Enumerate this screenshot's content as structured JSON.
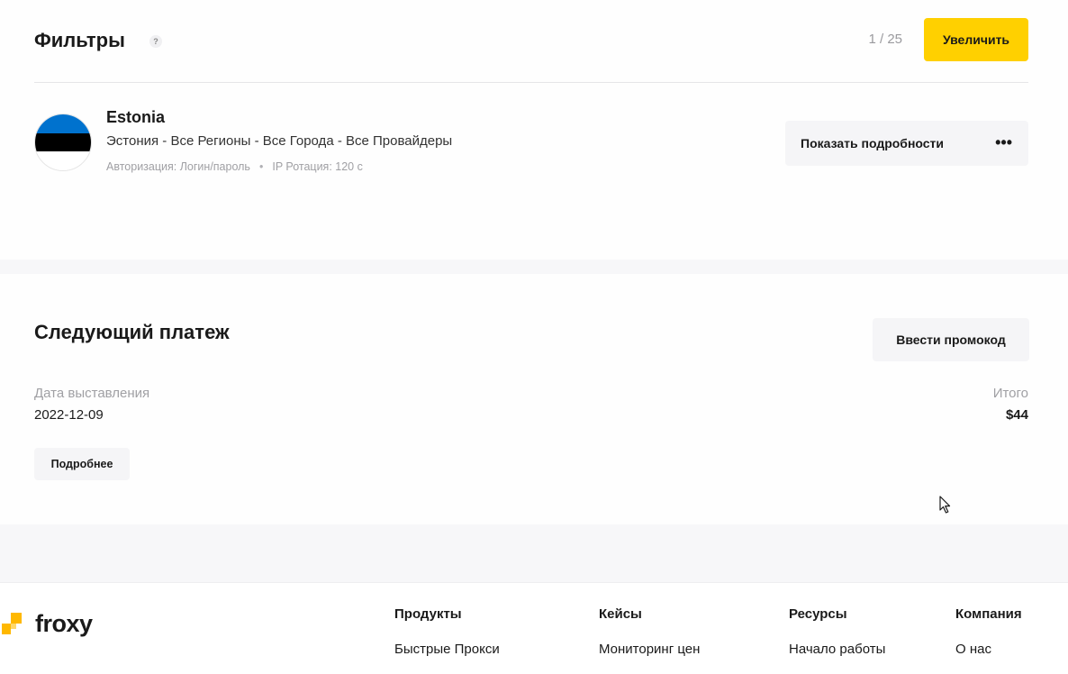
{
  "filters": {
    "title": "Фильтры",
    "help_glyph": "?",
    "page_counter": "1 / 25",
    "increase_label": "Увеличить"
  },
  "proxy": {
    "name": "Estonia",
    "location": "Эстония - Все Регионы - Все Города - Все Провайдеры",
    "auth": "Авторизация: Логин/пароль",
    "rotation": "IP Ротация: 120 с",
    "details_label": "Показать подробности",
    "more_glyph": "•••",
    "flag_colors": [
      "#0072ce",
      "#000000",
      "#ffffff"
    ]
  },
  "payment": {
    "title": "Следующий платеж",
    "promo_label": "Ввести промокод",
    "date_label": "Дата выставления",
    "date_value": "2022-12-09",
    "total_label": "Итого",
    "total_value": "$44",
    "more_label": "Подробнее"
  },
  "footer": {
    "logo_text": "froxy",
    "logo_color": "#ffb800",
    "columns": [
      {
        "heading": "Продукты",
        "link": "Быстрые Прокси"
      },
      {
        "heading": "Кейсы",
        "link": "Мониторинг цен"
      },
      {
        "heading": "Ресурсы",
        "link": "Начало работы"
      },
      {
        "heading": "Компания",
        "link": "О нас"
      }
    ]
  },
  "colors": {
    "accent": "#ffd000",
    "muted_text": "#a0a0a4"
  }
}
